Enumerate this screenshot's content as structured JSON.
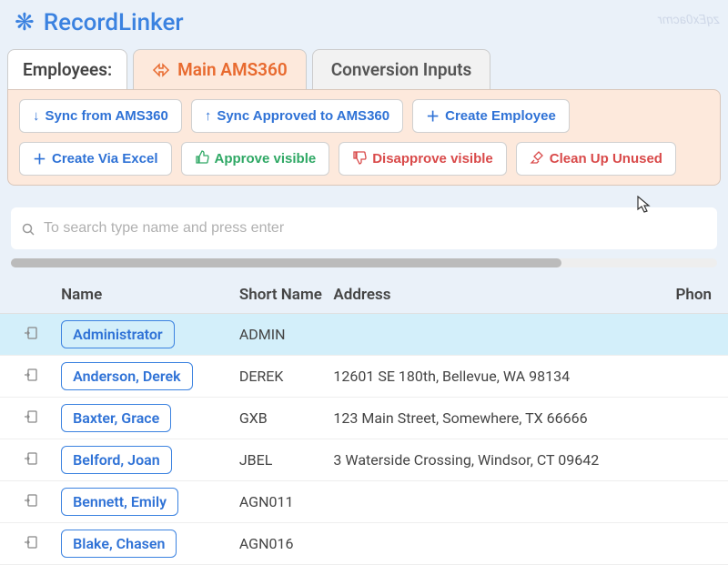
{
  "app": {
    "title": "RecordLinker",
    "watermark": "zqEx0acmr"
  },
  "tabs": {
    "label": "Employees:",
    "items": [
      {
        "label": "Main AMS360",
        "active": true
      },
      {
        "label": "Conversion Inputs",
        "active": false
      }
    ]
  },
  "toolbar": {
    "sync_from": "Sync from AMS360",
    "sync_to": "Sync Approved to AMS360",
    "create_emp": "Create Employee",
    "create_excel": "Create Via Excel",
    "approve": "Approve visible",
    "disapprove": "Disapprove visible",
    "cleanup": "Clean Up Unused"
  },
  "search": {
    "placeholder": "To search type name and press enter"
  },
  "table": {
    "headers": {
      "name": "Name",
      "short": "Short Name",
      "address": "Address",
      "phone": "Phon"
    },
    "rows": [
      {
        "name": "Administrator",
        "short": "ADMIN",
        "address": "",
        "highlight": true
      },
      {
        "name": "Anderson, Derek",
        "short": "DEREK",
        "address": "12601 SE 180th, Bellevue, WA 98134"
      },
      {
        "name": "Baxter, Grace",
        "short": "GXB",
        "address": "123 Main Street, Somewhere, TX 66666"
      },
      {
        "name": "Belford, Joan",
        "short": "JBEL",
        "address": "3 Waterside Crossing, Windsor, CT 09642"
      },
      {
        "name": "Bennett, Emily",
        "short": "AGN011",
        "address": ""
      },
      {
        "name": "Blake, Chasen",
        "short": "AGN016",
        "address": ""
      }
    ]
  }
}
